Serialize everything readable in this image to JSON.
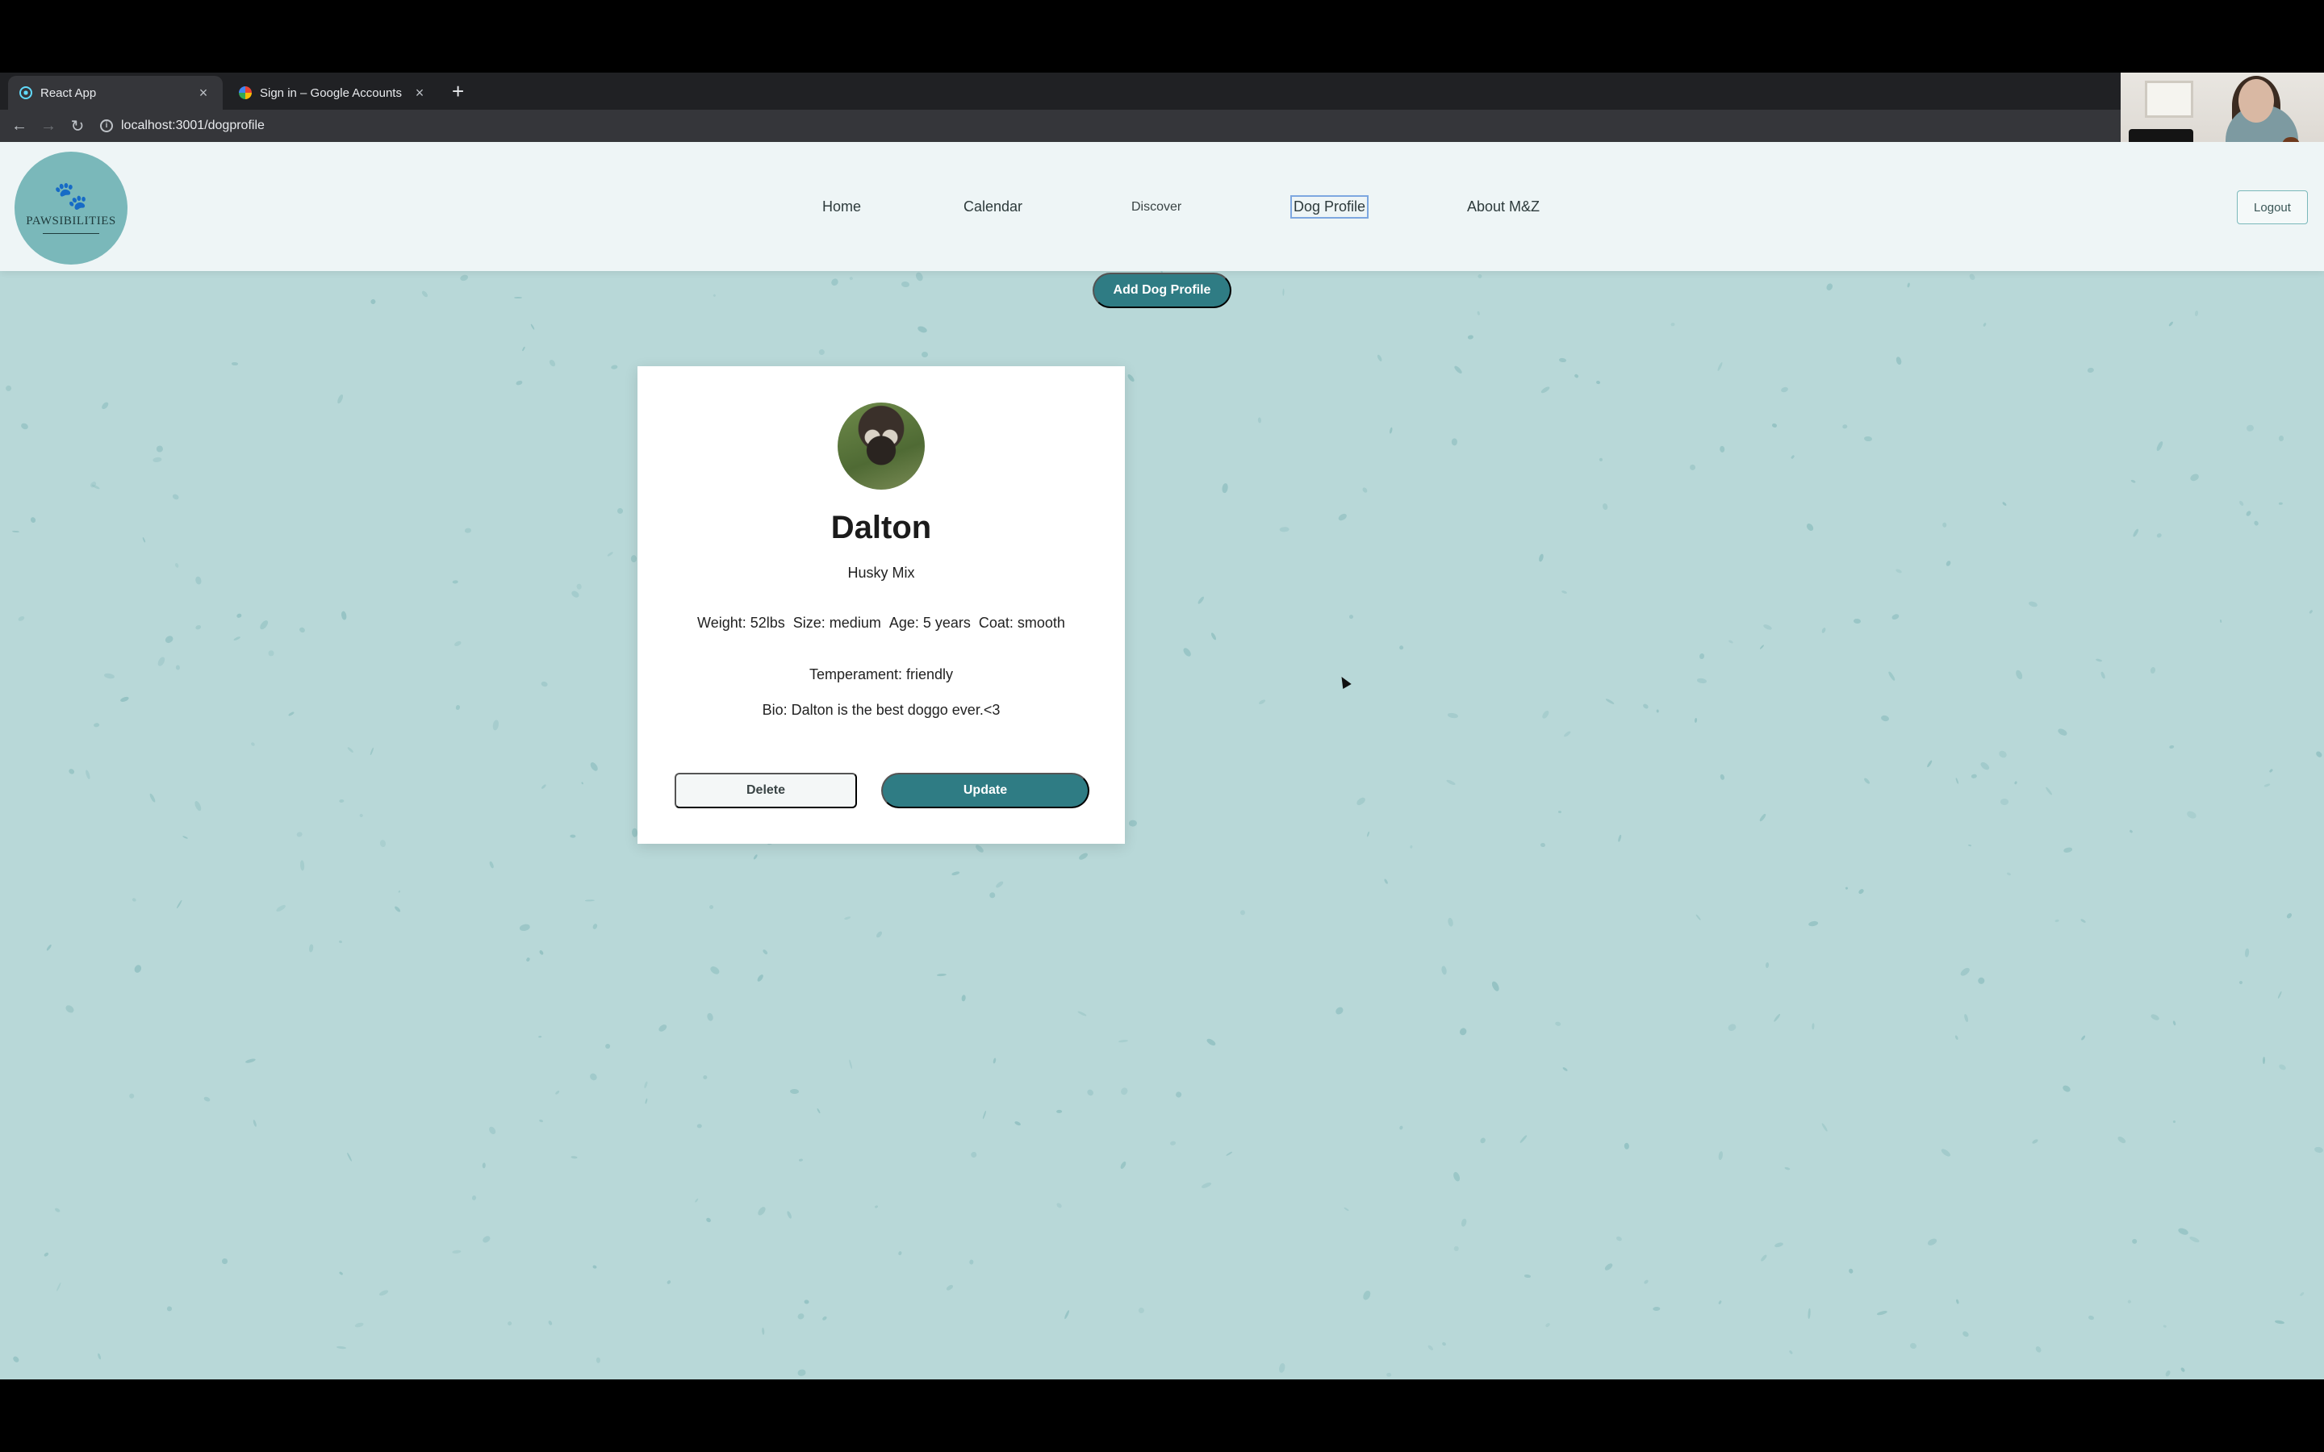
{
  "browser": {
    "tabs": [
      {
        "title": "React App",
        "active": true,
        "icon": "react-favicon"
      },
      {
        "title": "Sign in – Google Accounts",
        "active": false,
        "icon": "google-favicon"
      }
    ],
    "new_tab_icon": "plus-icon",
    "url": "localhost:3001/dogprofile"
  },
  "site": {
    "logo_text": "PAWSIBILITIES",
    "logo_icon": "paw-icon",
    "nav": {
      "home": "Home",
      "calendar": "Calendar",
      "discover": "Discover",
      "dog_profile": "Dog Profile",
      "about": "About M&Z"
    },
    "active_nav": "Dog Profile",
    "logout_label": "Logout"
  },
  "main": {
    "add_button": "Add Dog Profile",
    "dog": {
      "name": "Dalton",
      "breed": "Husky Mix",
      "weight": "Weight: 52lbs",
      "size": "Size: medium",
      "age": "Age: 5 years",
      "coat": "Coat: smooth",
      "temperament": "Temperament: friendly",
      "bio": "Bio: Dalton is the best doggo ever.<3"
    },
    "delete_label": "Delete",
    "update_label": "Update"
  },
  "colors": {
    "background": "#b8d8d8",
    "accent": "#2f7c84",
    "header": "#eef5f6"
  }
}
